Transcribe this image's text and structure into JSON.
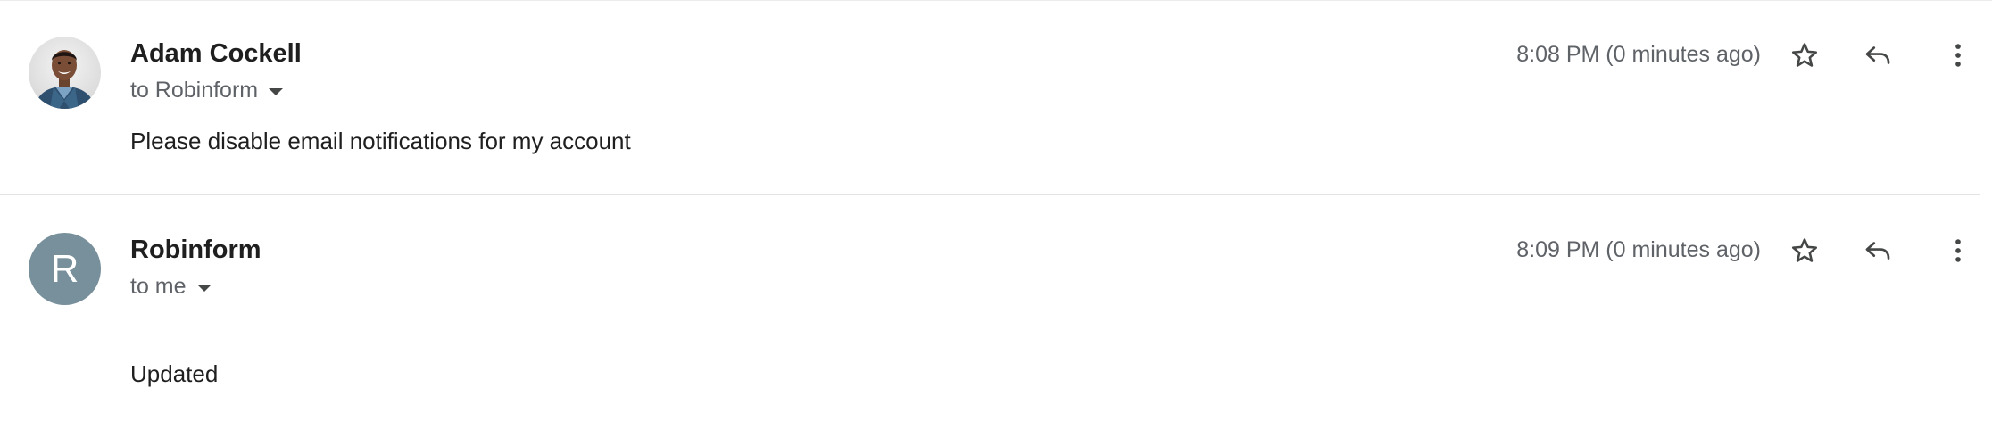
{
  "messages": [
    {
      "sender": "Adam Cockell",
      "recipient": "to Robinform",
      "timestamp": "8:08 PM (0 minutes ago)",
      "body": "Please disable email notifications for my account",
      "avatar": {
        "type": "photo",
        "icon": "person-photo"
      }
    },
    {
      "sender": "Robinform",
      "recipient": "to me",
      "timestamp": "8:09 PM (0 minutes ago)",
      "body": "Updated",
      "avatar": {
        "type": "letter",
        "letter": "R",
        "color": "#78909c"
      }
    }
  ],
  "icons": {
    "star": "star-outline-icon",
    "reply": "reply-icon",
    "more": "more-vert-icon",
    "caret": "caret-down-icon"
  },
  "colors": {
    "text_primary": "#1f1f1f",
    "text_secondary": "#5f6368",
    "divider": "#e3e3e3",
    "letter_avatar": "#78909c"
  }
}
